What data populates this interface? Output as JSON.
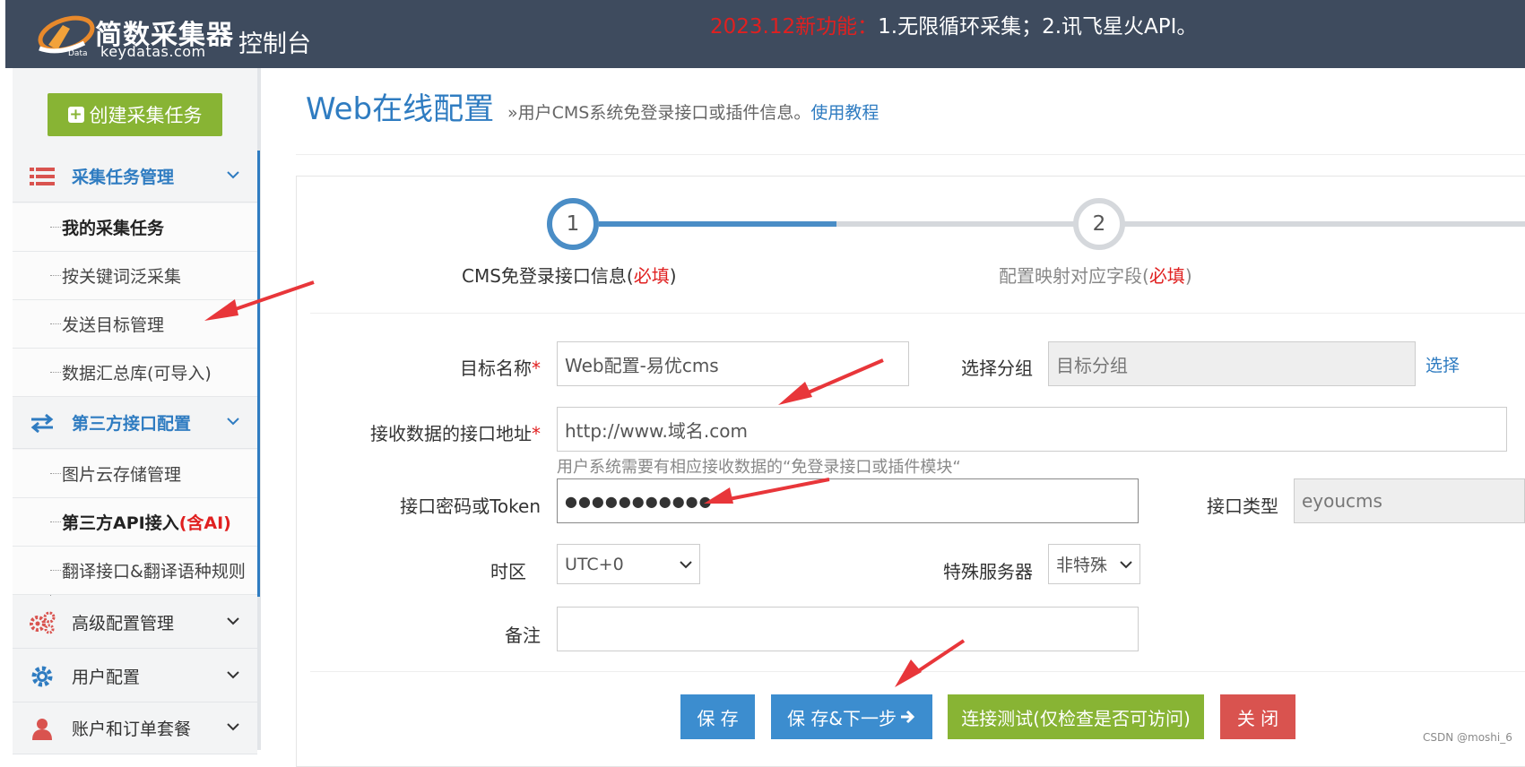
{
  "header": {
    "brand_cn": "简数采集器",
    "brand_en": "keydatas.com",
    "console": "控制台",
    "notice_highlight": "2023.12新功能：",
    "notice_text": "1.无限循环采集；2.讯飞星火API。"
  },
  "sidebar": {
    "create_button": "创建采集任务",
    "groups": [
      {
        "label": "采集任务管理",
        "icon": "list-icon",
        "expanded": true,
        "items": [
          "我的采集任务",
          "按关键词泛采集",
          "发送目标管理",
          "数据汇总库(可导入)"
        ]
      },
      {
        "label": "第三方接口配置",
        "icon": "exchange-icon",
        "expanded": true,
        "items": [
          "图片云存储管理",
          "第三方API接入",
          "翻译接口&翻译语种规则"
        ],
        "ai_badge": "(含AI)"
      },
      {
        "label": "高级配置管理",
        "icon": "gears-icon"
      },
      {
        "label": "用户配置",
        "icon": "gear-icon"
      },
      {
        "label": "账户和订单套餐",
        "icon": "user-icon"
      }
    ]
  },
  "main": {
    "title": "Web在线配置",
    "subtitle": "»用户CMS系统免登录接口或插件信息。",
    "tutorial_link": "使用教程",
    "steps": [
      {
        "number": "1",
        "label": "CMS免登录接口信息(",
        "required": "必填",
        "close": ")",
        "active": true
      },
      {
        "number": "2",
        "label": "配置映射对应字段(",
        "required": "必填",
        "close": ")",
        "active": false
      }
    ],
    "form": {
      "target_name_label": "目标名称",
      "target_name_value": "Web配置-易优cms",
      "group_label": "选择分组",
      "group_placeholder": "目标分组",
      "group_link": "选择",
      "api_url_label": "接收数据的接口地址",
      "api_url_value": "http://www.域名.com",
      "api_url_hint": "用户系统需要有相应接收数据的“免登录接口或插件模块“",
      "token_label": "接口密码或Token",
      "token_value": "●●●●●●●●●●●",
      "type_label": "接口类型",
      "type_value": "eyoucms",
      "timezone_label": "时区",
      "timezone_value": "UTC+0",
      "server_label": "特殊服务器",
      "server_value": "非特殊",
      "note_label": "备注",
      "note_value": "",
      "required_mark": "*"
    },
    "buttons": {
      "save": "保 存",
      "save_next": "保 存&下一步",
      "test": "连接测试(仅检查是否可访问)",
      "close": "关 闭"
    }
  },
  "watermark": "CSDN @moshi_6",
  "colors": {
    "header_bg": "#3e4b5e",
    "accent_blue": "#2f7cc1",
    "button_blue": "#3c8dcf",
    "green": "#88b434",
    "red": "#d9534f",
    "required_red": "#e02020"
  }
}
